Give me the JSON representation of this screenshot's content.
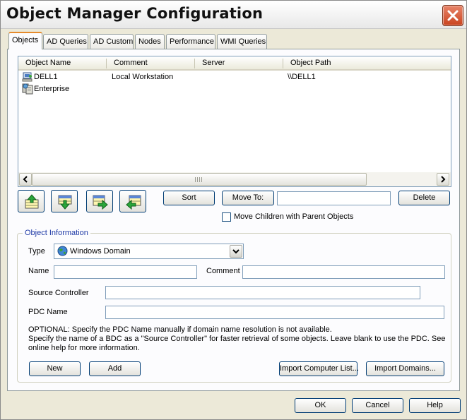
{
  "window": {
    "title": "Object Manager Configuration"
  },
  "tabs": [
    "Objects",
    "AD Queries",
    "AD Custom",
    "Nodes",
    "Performance",
    "WMI Queries"
  ],
  "list": {
    "columns": [
      "Object Name",
      "Comment",
      "Server",
      "Object Path"
    ],
    "rows": [
      {
        "name": "DELL1",
        "comment": "Local Workstation",
        "server": "",
        "path": "\\\\DELL1",
        "icon": "computer-icon"
      },
      {
        "name": "Enterprise",
        "comment": "",
        "server": "",
        "path": "",
        "icon": "enterprise-icon"
      }
    ]
  },
  "toolbar": {
    "move_top": "move-to-top-icon",
    "move_down": "move-down-icon",
    "move_right": "move-right-icon",
    "move_back": "move-back-icon",
    "sort_label": "Sort",
    "move_to_label": "Move To:",
    "move_to_value": "",
    "delete_label": "Delete",
    "move_children_label": "Move Children with Parent Objects",
    "move_children_checked": false
  },
  "object_info": {
    "legend": "Object Information",
    "type_label": "Type",
    "type_value": "Windows Domain",
    "name_label": "Name",
    "name_value": "",
    "comment_label": "Comment",
    "comment_value": "",
    "source_controller_label": "Source Controller",
    "source_controller_value": "",
    "pdc_label": "PDC Name",
    "pdc_value": "",
    "note_line1": "OPTIONAL: Specify the PDC Name manually if domain name resolution is not available.",
    "note_line2": "Specify the name of a BDC as a \"Source Controller\" for faster retrieval of some objects.  Leave blank to use the PDC.  See",
    "note_line3": "online help for more information.",
    "new_label": "New",
    "add_label": "Add",
    "import_computer_label": "Import Computer List...",
    "import_domains_label": "Import Domains..."
  },
  "footer": {
    "ok_label": "OK",
    "cancel_label": "Cancel",
    "help_label": "Help"
  },
  "colors": {
    "accent_tab": "#e68b2c",
    "group_legend": "#1f3aa6",
    "close_button": "#c9431f"
  }
}
